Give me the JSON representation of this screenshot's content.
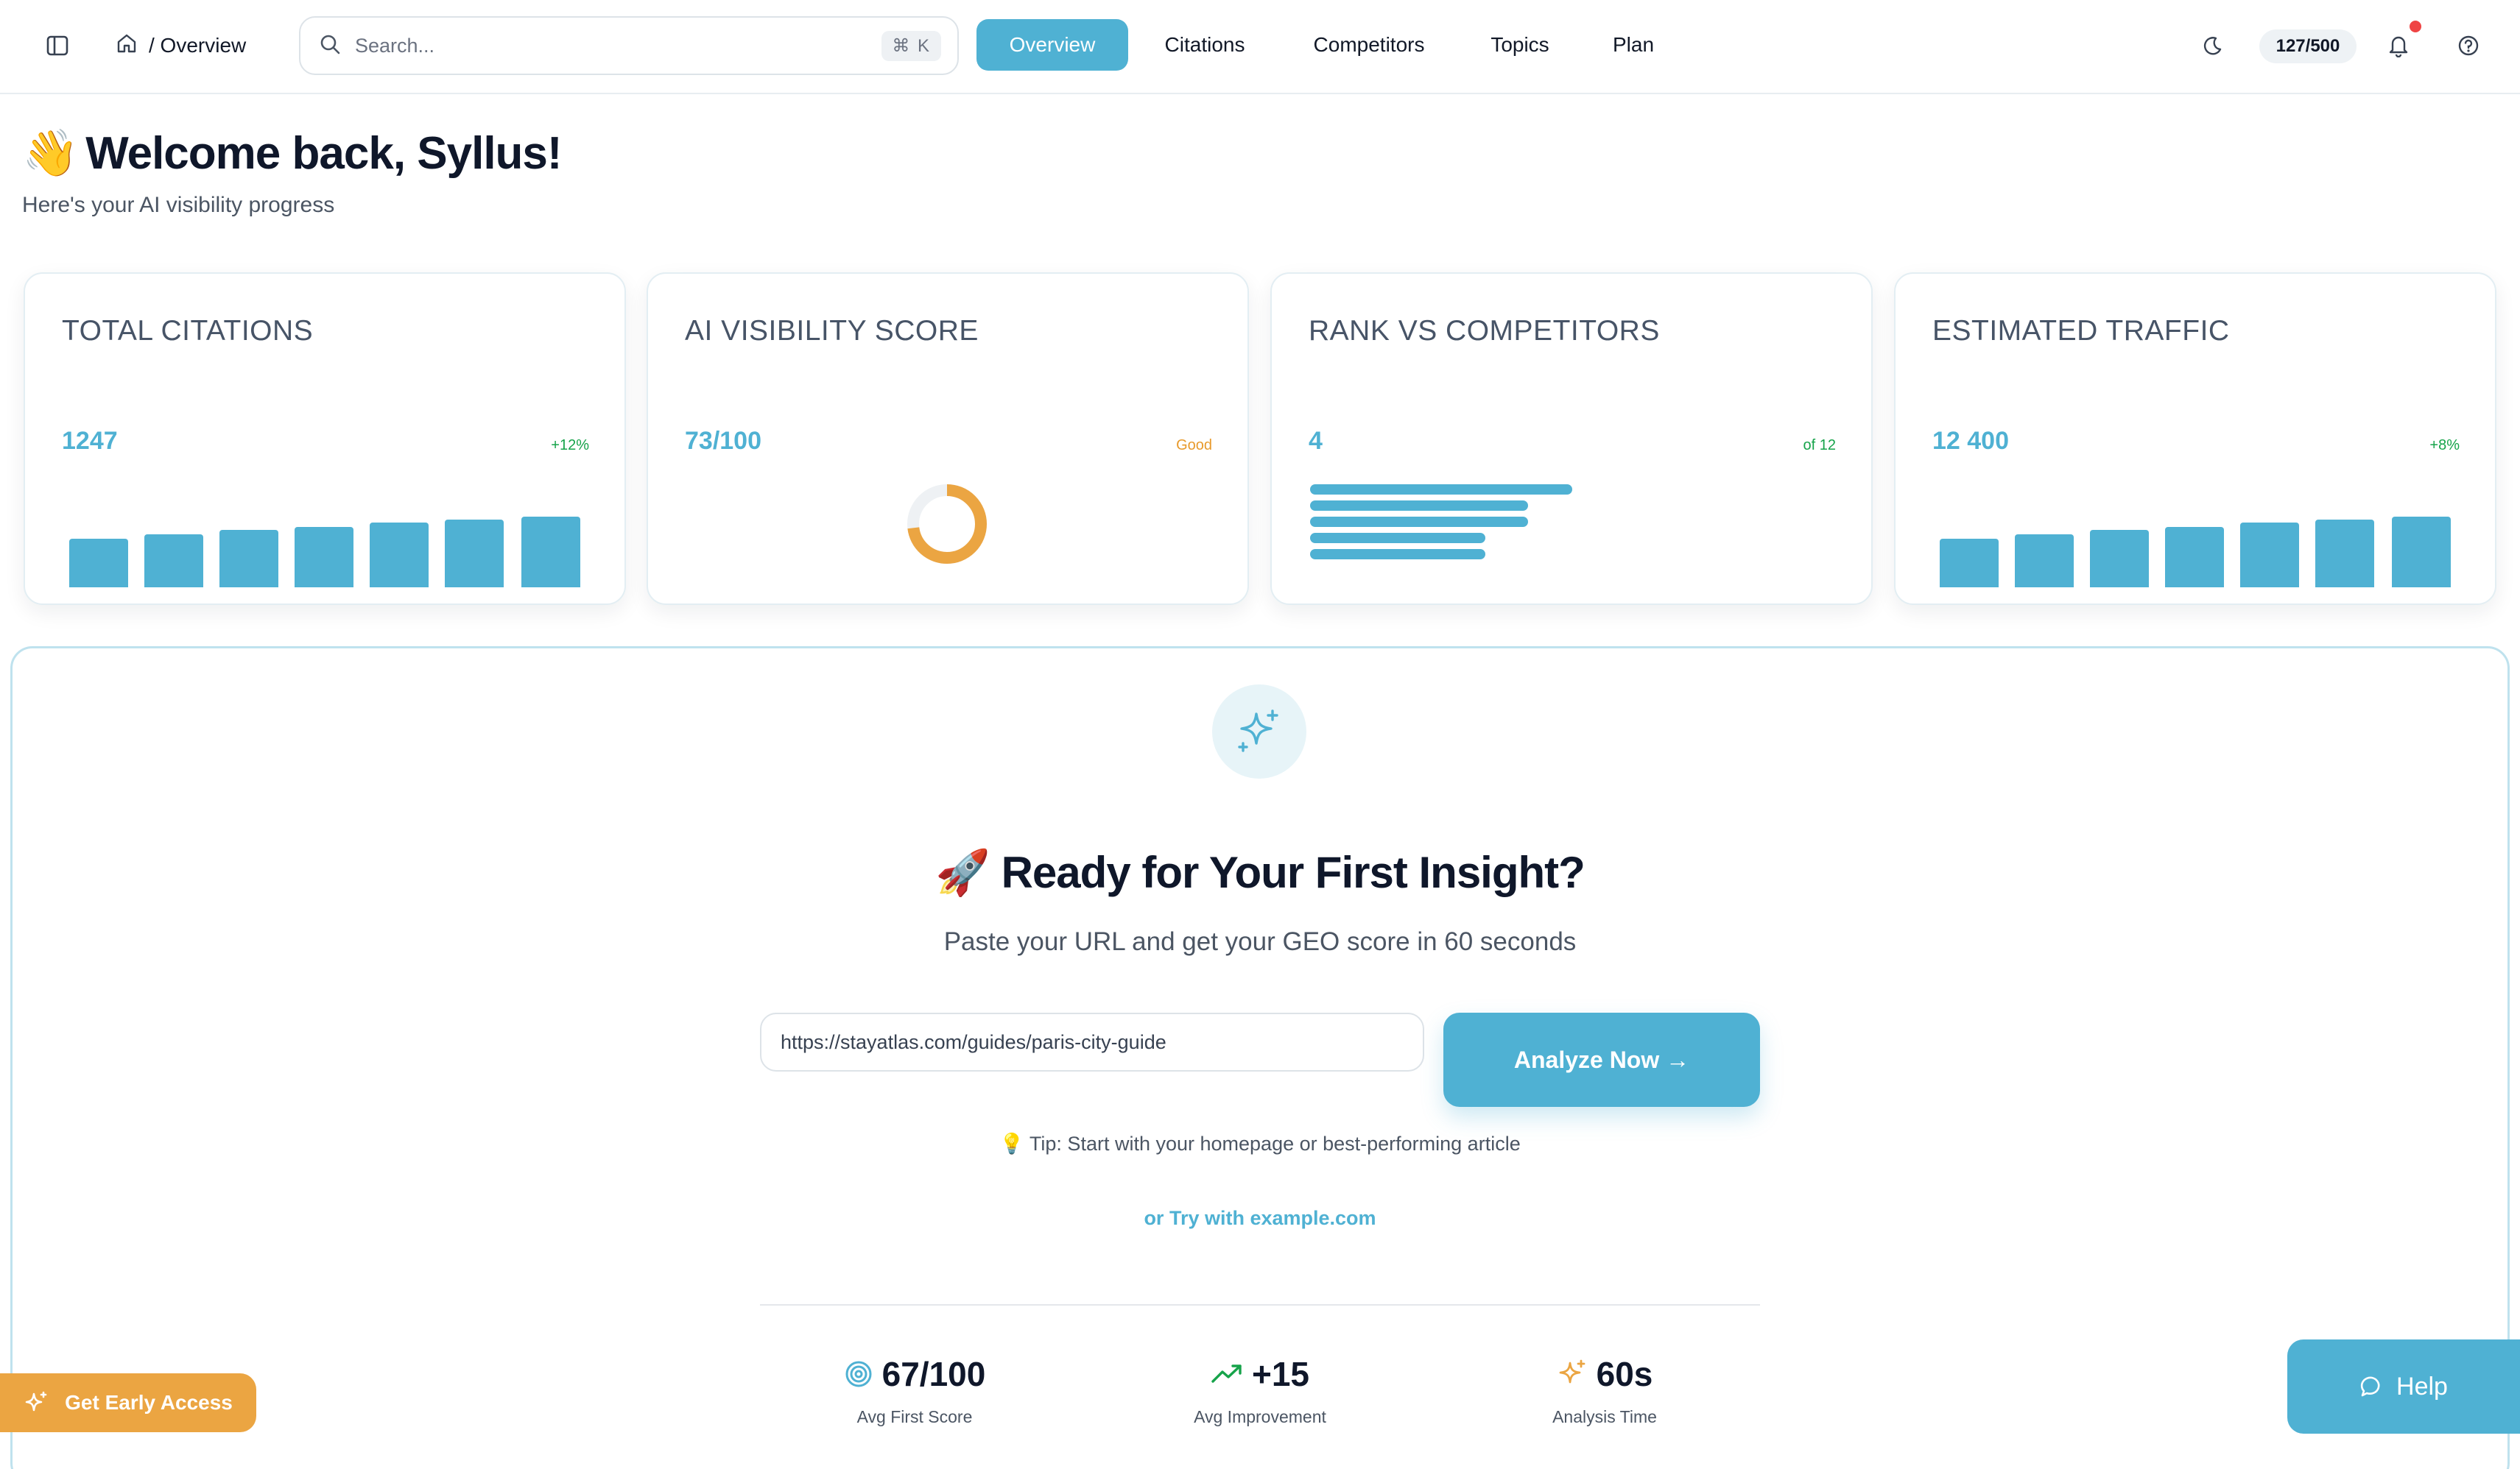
{
  "header": {
    "breadcrumb": "/ Overview",
    "search": {
      "placeholder": "Search...",
      "shortcut": "⌘ K"
    },
    "nav": [
      {
        "label": "Overview",
        "active": true
      },
      {
        "label": "Citations",
        "active": false
      },
      {
        "label": "Competitors",
        "active": false
      },
      {
        "label": "Topics",
        "active": false
      },
      {
        "label": "Plan",
        "active": false
      }
    ],
    "quota": "127/500",
    "icons": [
      "sidebar-toggle-icon",
      "home-icon",
      "search-icon",
      "moon-icon",
      "bell-icon",
      "help-circle-icon"
    ],
    "notification_dot_color": "#ef4444"
  },
  "welcome": {
    "emoji": "👋",
    "title": "Welcome back, Syllus!",
    "subtitle": "Here's your AI visibility progress"
  },
  "cards": [
    {
      "title": "TOTAL CITATIONS",
      "value": "1247",
      "badge": "+12%",
      "badge_color": "#16a34a",
      "viz": "bars"
    },
    {
      "title": "AI VISIBILITY SCORE",
      "value": "73/100",
      "badge": "Good",
      "badge_color": "#e89a2c",
      "viz": "donut",
      "score_fraction": 0.73
    },
    {
      "title": "RANK VS COMPETITORS",
      "value": "4",
      "badge": "of 12",
      "badge_color": "#16a34a",
      "viz": "hbars"
    },
    {
      "title": "ESTIMATED TRAFFIC",
      "value": "12 400",
      "badge": "+8%",
      "badge_color": "#16a34a",
      "viz": "bars"
    }
  ],
  "cta": {
    "emoji": "🚀",
    "title": "Ready for Your First Insight?",
    "subtitle": "Paste your URL and get your GEO score in 60 seconds",
    "url_value": "https://stayatlas.com/guides/paris-city-guide",
    "button": "Analyze Now →",
    "tip_icon": "💡",
    "tip": "Tip: Start with your homepage or best-performing article",
    "try_link": "or Try with example.com",
    "icon": "sparkles-icon"
  },
  "stats": [
    {
      "value": "67/100",
      "label": "Avg First Score",
      "icon": "target-icon",
      "color": "#4fb1d3"
    },
    {
      "value": "+15",
      "label": "Avg Improvement",
      "icon": "trending-up-icon",
      "color": "#16a34a"
    },
    {
      "value": "60s",
      "label": "Analysis Time",
      "icon": "sparkles-icon",
      "color": "#eba542"
    }
  ],
  "early_access": "Get Early Access",
  "help": "Help",
  "colors": {
    "accent": "#4fb1d3",
    "warning": "#eba542",
    "success": "#16a34a"
  }
}
